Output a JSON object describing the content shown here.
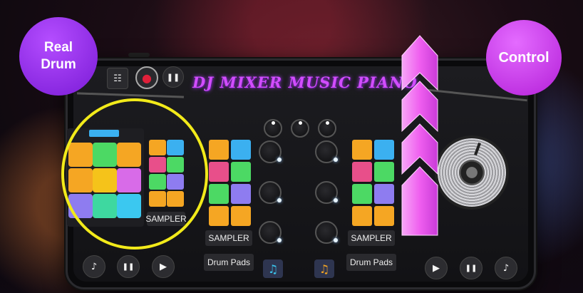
{
  "app": {
    "title": "DJ MIXER MUSIC PIANO"
  },
  "badges": {
    "left": "Real\nDrum",
    "right": "Control"
  },
  "badge_lines": {
    "left_1": "Real",
    "left_2": "Drum",
    "right": "Control"
  },
  "top_controls": {
    "equalizer_icon": "☷",
    "record_icon": "●",
    "pause_icon": "❚❚"
  },
  "left_deck": {
    "sampler_label": "SAMPLER"
  },
  "center": {
    "left_sampler_label": "SAMPLER",
    "right_sampler_label": "SAMPLER",
    "left_drum_pads_label": "Drum Pads",
    "right_drum_pads_label": "Drum Pads"
  },
  "bottom_left": {
    "music_icon": "♪",
    "pause_icon": "❚❚",
    "play_icon": "▶"
  },
  "bottom_right": {
    "play_icon": "▶",
    "pause_icon": "❚❚",
    "music_icon": "♪"
  },
  "center_icons": {
    "left_note": "♫",
    "right_note": "♫"
  },
  "colors": {
    "accent": "#d24dff",
    "highlight_ring": "#f2ea1a",
    "pad_orange": "#f5a623",
    "pad_green": "#4cd964",
    "pad_pink": "#e84f8a",
    "pad_blue": "#3bb0f0",
    "pad_purple": "#8e7cf0",
    "arrow_pink": "#f06bf0"
  }
}
